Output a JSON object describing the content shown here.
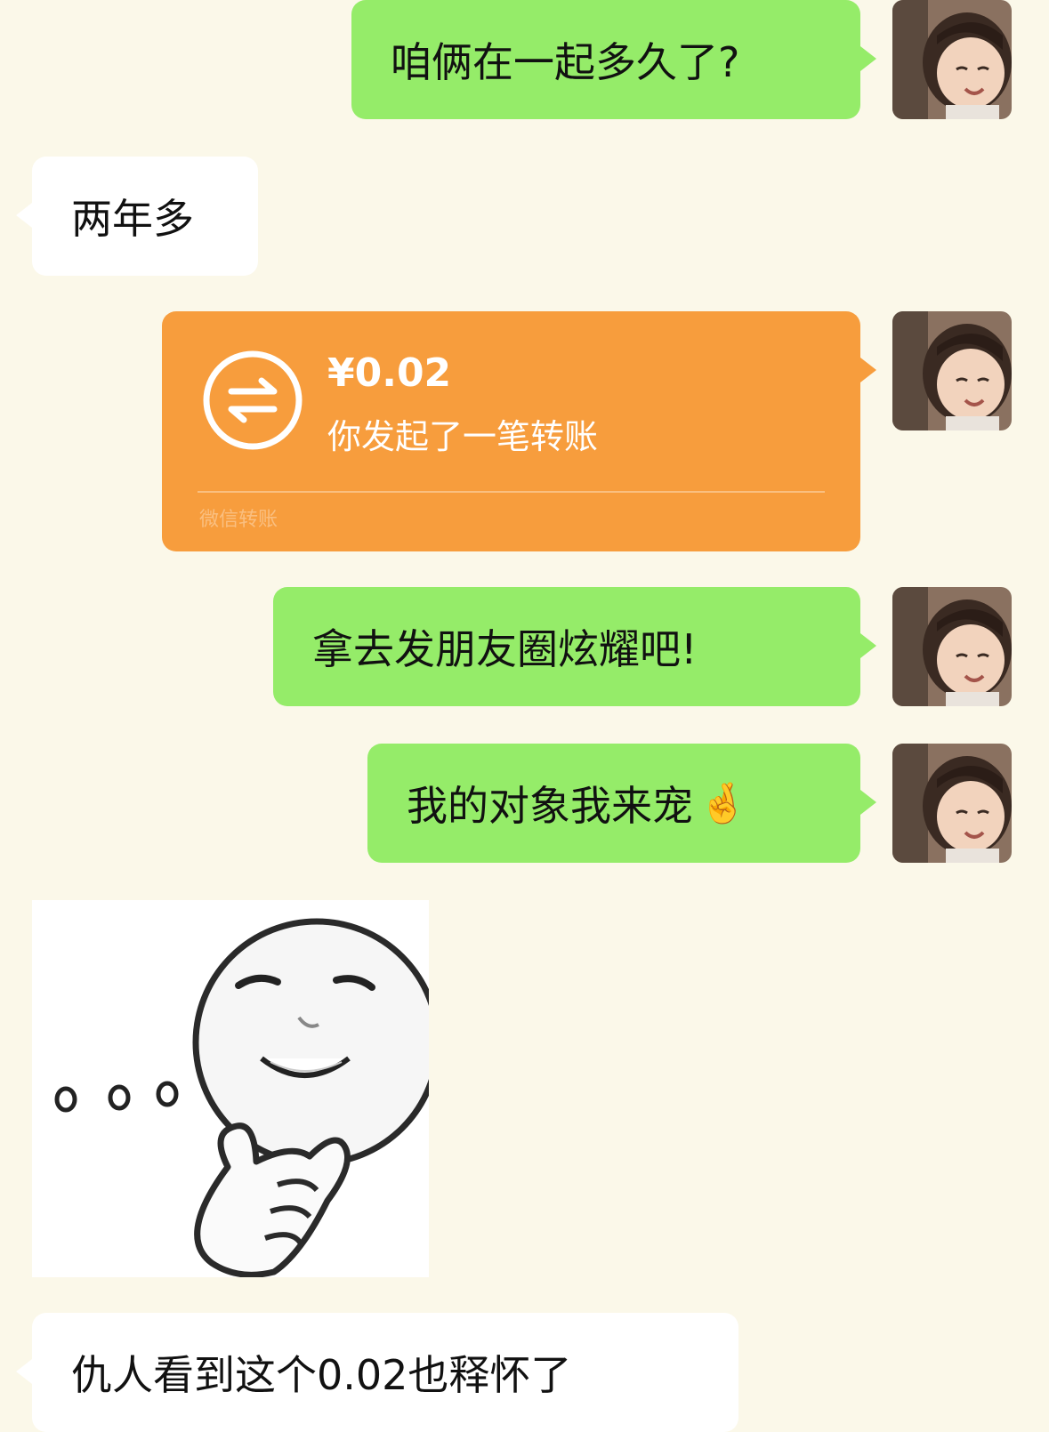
{
  "messages": [
    {
      "side": "out",
      "text": "咱俩在一起多久了?"
    },
    {
      "side": "in",
      "text": "两年多"
    },
    {
      "side": "out",
      "type": "transfer",
      "amount": "¥0.02",
      "description": "你发起了一笔转账",
      "footer": "微信转账"
    },
    {
      "side": "out",
      "text": "拿去发朋友圈炫耀吧!"
    },
    {
      "side": "out",
      "text": "我的对象我来宠",
      "emoji": "🤞"
    },
    {
      "side": "in",
      "type": "sticker",
      "sticker_caption": "..."
    },
    {
      "side": "in",
      "text": "仇人看到这个0.02也释怀了"
    }
  ],
  "colors": {
    "background": "#fbf8e9",
    "outgoing_bubble": "#95ec69",
    "incoming_bubble": "#ffffff",
    "transfer_card": "#f79d3d"
  },
  "icons": {
    "transfer": "transfer-arrows-icon",
    "avatar": "user-avatar-girl-photo"
  }
}
